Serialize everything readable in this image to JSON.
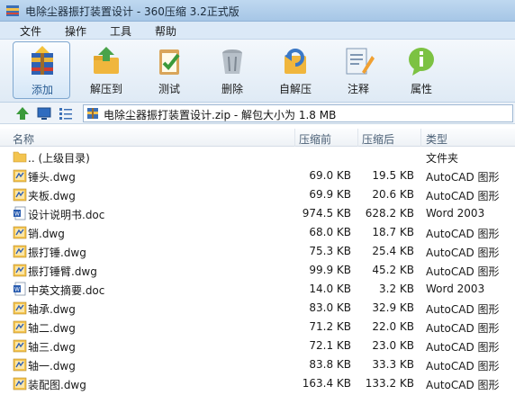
{
  "window": {
    "title": "电除尘器振打装置设计 - 360压缩 3.2正式版"
  },
  "menu": [
    "文件",
    "操作",
    "工具",
    "帮助"
  ],
  "toolbar": [
    {
      "label": "添加",
      "icon": "add-archive-icon",
      "active": true
    },
    {
      "label": "解压到",
      "icon": "extract-to-icon"
    },
    {
      "label": "测试",
      "icon": "test-icon"
    },
    {
      "label": "删除",
      "icon": "delete-icon"
    },
    {
      "label": "自解压",
      "icon": "self-extract-icon"
    },
    {
      "label": "注释",
      "icon": "comment-icon"
    },
    {
      "label": "属性",
      "icon": "properties-icon"
    }
  ],
  "address": {
    "text": "电除尘器振打装置设计.zip - 解包大小为 1.8 MB"
  },
  "columns": {
    "name": "名称",
    "size": "压缩前",
    "compressed": "压缩后",
    "type": "类型"
  },
  "files": [
    {
      "name": ".. (上级目录)",
      "size": "",
      "compressed": "",
      "type": "文件夹",
      "icon": "folder-icon"
    },
    {
      "name": "锤头.dwg",
      "size": "69.0 KB",
      "compressed": "19.5 KB",
      "type": "AutoCAD 图形",
      "icon": "dwg-file-icon"
    },
    {
      "name": "夹板.dwg",
      "size": "69.9 KB",
      "compressed": "20.6 KB",
      "type": "AutoCAD 图形",
      "icon": "dwg-file-icon"
    },
    {
      "name": "设计说明书.doc",
      "size": "974.5 KB",
      "compressed": "628.2 KB",
      "type": "Word 2003",
      "icon": "word-file-icon"
    },
    {
      "name": "销.dwg",
      "size": "68.0 KB",
      "compressed": "18.7 KB",
      "type": "AutoCAD 图形",
      "icon": "dwg-file-icon"
    },
    {
      "name": "振打锤.dwg",
      "size": "75.3 KB",
      "compressed": "25.4 KB",
      "type": "AutoCAD 图形",
      "icon": "dwg-file-icon"
    },
    {
      "name": "振打锤臂.dwg",
      "size": "99.9 KB",
      "compressed": "45.2 KB",
      "type": "AutoCAD 图形",
      "icon": "dwg-file-icon"
    },
    {
      "name": "中英文摘要.doc",
      "size": "14.0 KB",
      "compressed": "3.2 KB",
      "type": "Word 2003",
      "icon": "word-file-icon"
    },
    {
      "name": "轴承.dwg",
      "size": "83.0 KB",
      "compressed": "32.9 KB",
      "type": "AutoCAD 图形",
      "icon": "dwg-file-icon"
    },
    {
      "name": "轴二.dwg",
      "size": "71.2 KB",
      "compressed": "22.0 KB",
      "type": "AutoCAD 图形",
      "icon": "dwg-file-icon"
    },
    {
      "name": "轴三.dwg",
      "size": "72.1 KB",
      "compressed": "23.0 KB",
      "type": "AutoCAD 图形",
      "icon": "dwg-file-icon"
    },
    {
      "name": "轴一.dwg",
      "size": "83.8 KB",
      "compressed": "33.3 KB",
      "type": "AutoCAD 图形",
      "icon": "dwg-file-icon"
    },
    {
      "name": "装配图.dwg",
      "size": "163.4 KB",
      "compressed": "133.2 KB",
      "type": "AutoCAD 图形",
      "icon": "dwg-file-icon"
    }
  ]
}
